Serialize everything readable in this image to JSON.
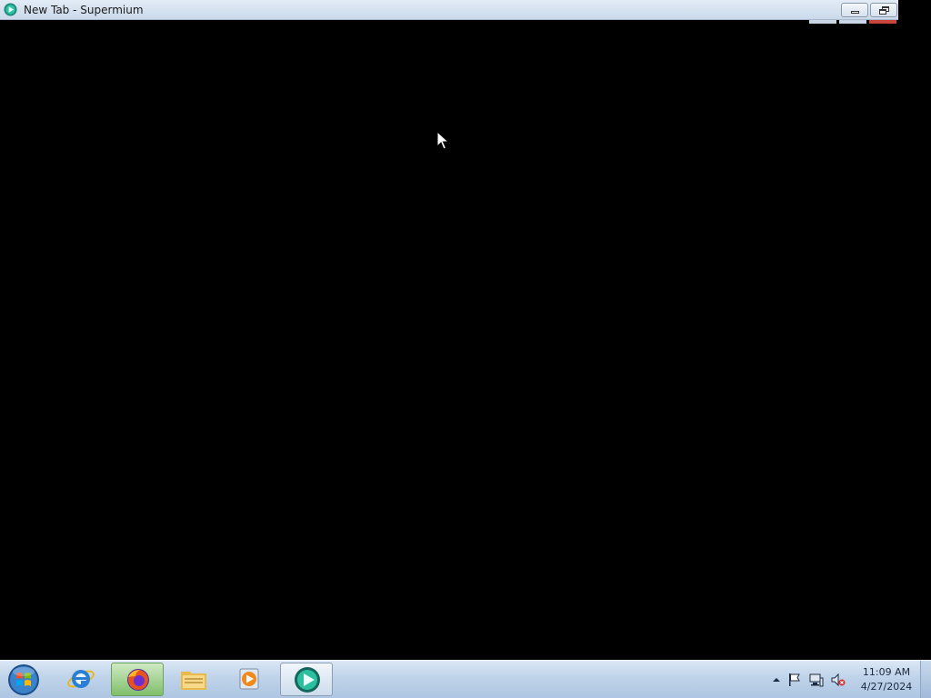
{
  "window": {
    "title": "New Tab - Supermium",
    "app_icon": "supermium-icon",
    "controls": [
      "minimize-button",
      "restore-button"
    ]
  },
  "content": {
    "background_color": "#000000"
  },
  "taskbar": {
    "start": {
      "icon": "windows-start-orb-icon"
    },
    "pinned": [
      {
        "name": "internet-explorer",
        "icon": "internet-explorer-icon",
        "state": "idle"
      },
      {
        "name": "firefox",
        "icon": "firefox-icon",
        "state": "running"
      },
      {
        "name": "windows-explorer",
        "icon": "folder-icon",
        "state": "idle"
      },
      {
        "name": "media-player",
        "icon": "media-player-icon",
        "state": "idle"
      },
      {
        "name": "supermium",
        "icon": "supermium-icon",
        "state": "active"
      }
    ],
    "tray": {
      "icons": [
        "show-hidden-icons-arrow-icon",
        "action-center-flag-icon",
        "network-icon",
        "volume-muted-icon"
      ]
    },
    "clock": {
      "time": "11:09 AM",
      "date": "4/27/2024"
    }
  },
  "colors": {
    "title_bar": "#d6e2f0",
    "taskbar": "#bfd3ea",
    "close_accent": "#c9443b",
    "running_highlight": "#7fbf6a"
  }
}
